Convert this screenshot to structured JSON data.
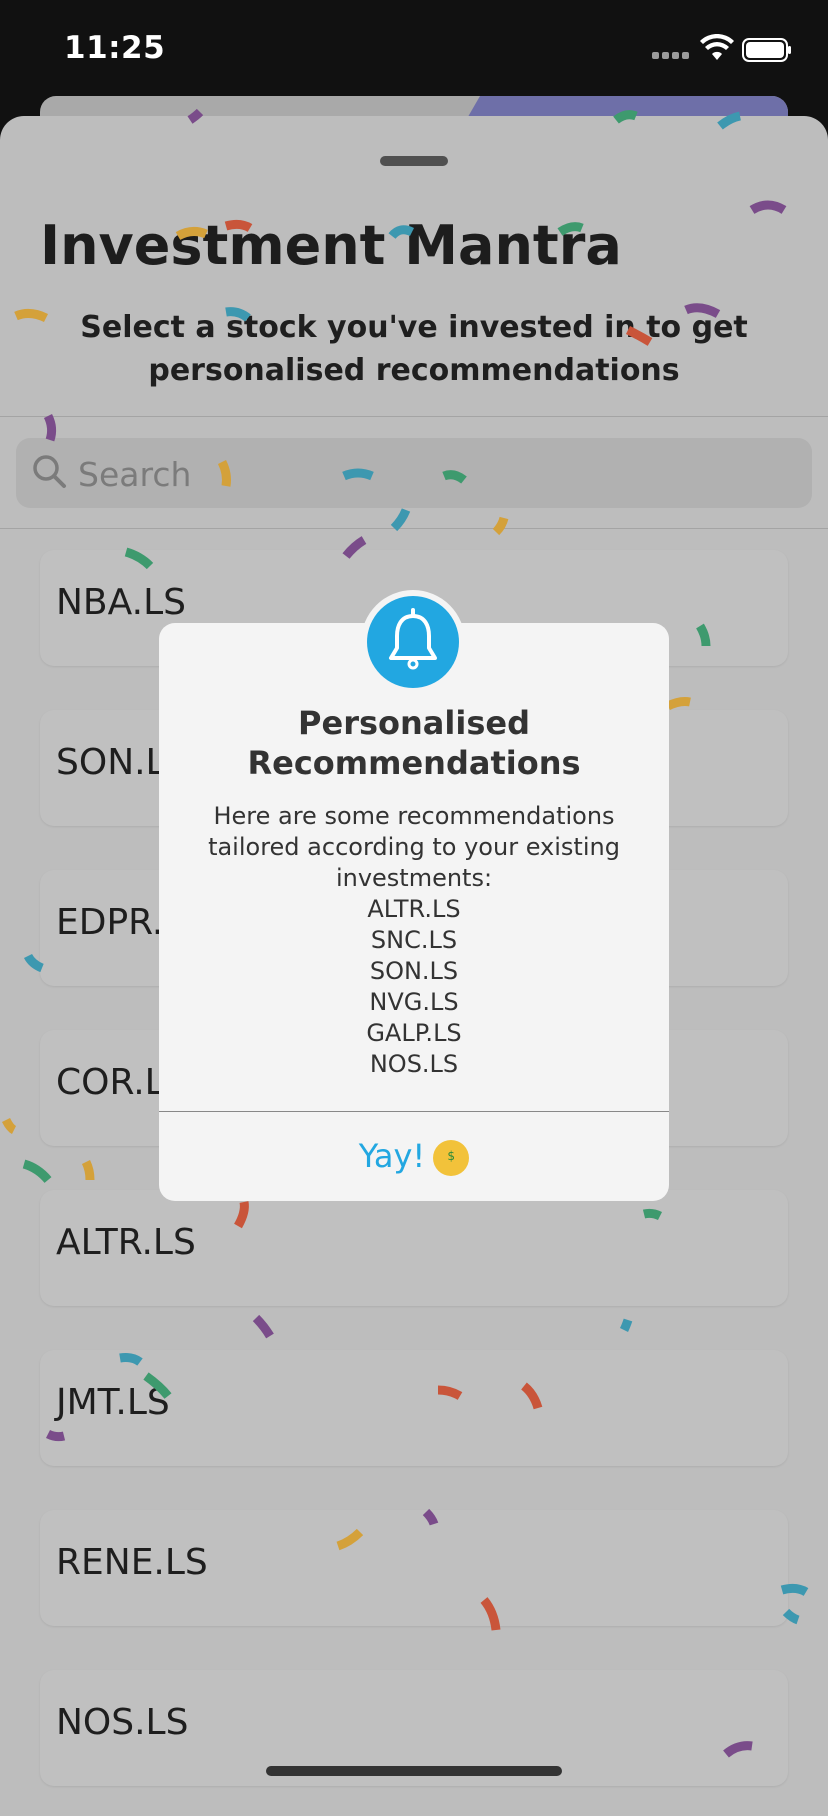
{
  "status_bar": {
    "time": "11:25"
  },
  "header": {
    "title": "Investment Mantra",
    "subtitle": "Select a stock you've invested in to get personalised recommendations"
  },
  "search": {
    "placeholder": "Search"
  },
  "stocks": [
    "NBA.LS",
    "SON.LS",
    "EDPR.LS",
    "COR.LS",
    "ALTR.LS",
    "JMT.LS",
    "RENE.LS",
    "NOS.LS"
  ],
  "alert": {
    "title": "Personalised Recommendations",
    "message": "Here are some recommendations tailored according to your existing investments:",
    "recommendations": [
      "ALTR.LS",
      "SNC.LS",
      "SON.LS",
      "NVG.LS",
      "GALP.LS",
      "NOS.LS"
    ],
    "button_label": "Yay!",
    "icon": "bell-icon",
    "button_emoji": "money-mouth-face-icon"
  },
  "colors": {
    "accent": "#22a7e1",
    "overlay": "#bdbdbd"
  }
}
